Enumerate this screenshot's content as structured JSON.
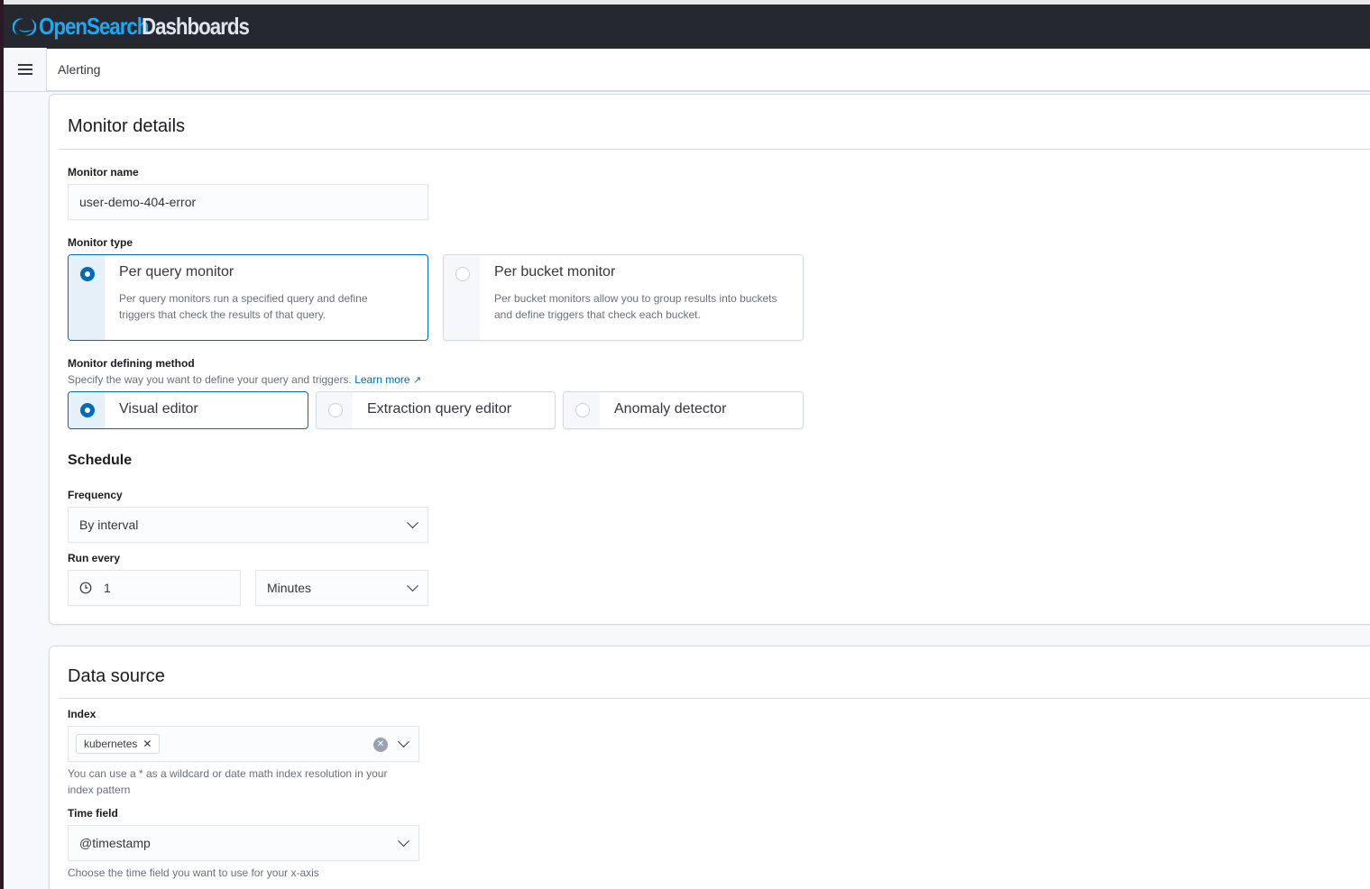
{
  "app": {
    "brand_part1": "OpenSearch",
    "brand_part2": "Dashboards",
    "brand_color": "#1ba9f5",
    "menu_icon": "hamburger-menu-icon"
  },
  "header": {
    "breadcrumb": "Alerting"
  },
  "monitor_details": {
    "title": "Monitor details",
    "monitor_name_label": "Monitor name",
    "monitor_name_value": "user-demo-404-error",
    "monitor_type_label": "Monitor type",
    "monitor_types": [
      {
        "title": "Per query monitor",
        "description_line1": "Per query monitors run a specified query and define",
        "description_line2": "triggers that check the results of that query.",
        "selected": true
      },
      {
        "title": "Per bucket monitor",
        "description_line1": "Per bucket monitors allow you to group results into buckets",
        "description_line2": "and define triggers that check each bucket.",
        "selected": false
      }
    ],
    "defining_method_label": "Monitor defining method",
    "defining_method_help": "Specify the way you want to define your query and triggers.",
    "learn_more": "Learn more",
    "defining_methods": [
      {
        "label": "Visual editor",
        "selected": true
      },
      {
        "label": "Extraction query editor",
        "selected": false
      },
      {
        "label": "Anomaly detector",
        "selected": false
      }
    ],
    "schedule_title": "Schedule",
    "frequency_label": "Frequency",
    "frequency_value": "By interval",
    "run_every_label": "Run every",
    "run_every_value": "1",
    "run_every_unit": "Minutes"
  },
  "data_source": {
    "title": "Data source",
    "index_label": "Index",
    "index_values": [
      "kubernetes"
    ],
    "index_help_line1": "You can use a * as a wildcard or date math index resolution in your",
    "index_help_line2": "index pattern",
    "time_field_label": "Time field",
    "time_field_value": "@timestamp",
    "time_field_help": "Choose the time field you want to use for your x-axis"
  },
  "colors": {
    "accent": "#006bb8",
    "topbar": "#25282f"
  }
}
